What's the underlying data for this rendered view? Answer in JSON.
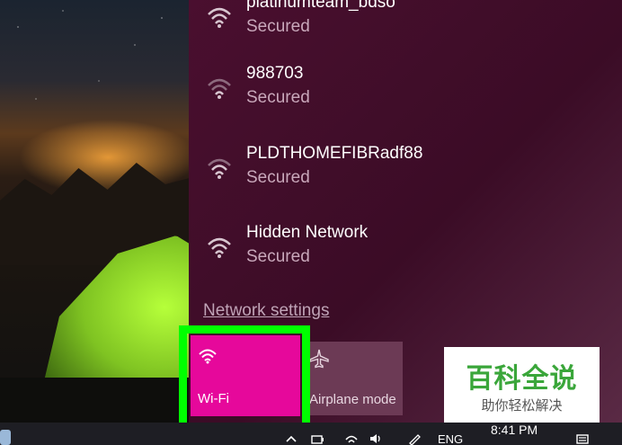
{
  "networks": [
    {
      "name": "platinumteam_bdso",
      "status": "Secured"
    },
    {
      "name": "988703",
      "status": "Secured"
    },
    {
      "name": "PLDTHOMEFIBRadf88",
      "status": "Secured"
    },
    {
      "name": "Hidden Network",
      "status": "Secured"
    }
  ],
  "network_settings_label": "Network settings",
  "quick_actions": {
    "wifi_label": "Wi-Fi",
    "airplane_label": "Airplane mode"
  },
  "taskbar": {
    "time": "8:41 PM",
    "language": "ENG"
  },
  "watermark": {
    "title": "百科全说",
    "subtitle": "助你轻松解决"
  },
  "colors": {
    "flyout_bg": "#4a0f2f",
    "wifi_tile": "#e6089b",
    "highlight": "#00ff00",
    "watermark_green": "#3aa63a"
  },
  "icons": [
    "wifi-icon",
    "airplane-icon",
    "chevron-up-icon",
    "power-icon",
    "speaker-icon",
    "notification-icon"
  ]
}
